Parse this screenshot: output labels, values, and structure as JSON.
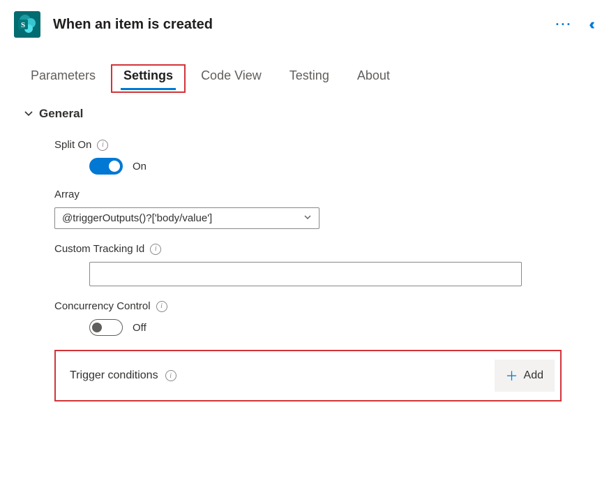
{
  "header": {
    "title": "When an item is created"
  },
  "tabs": {
    "items": [
      {
        "label": "Parameters"
      },
      {
        "label": "Settings"
      },
      {
        "label": "Code View"
      },
      {
        "label": "Testing"
      },
      {
        "label": "About"
      }
    ],
    "activeIndex": 1
  },
  "section": {
    "title": "General",
    "splitOn": {
      "label": "Split On",
      "state": "On"
    },
    "array": {
      "label": "Array",
      "value": "@triggerOutputs()?['body/value']"
    },
    "customTracking": {
      "label": "Custom Tracking Id",
      "value": ""
    },
    "concurrency": {
      "label": "Concurrency Control",
      "state": "Off"
    },
    "triggerConditions": {
      "label": "Trigger conditions",
      "addLabel": "Add"
    }
  }
}
